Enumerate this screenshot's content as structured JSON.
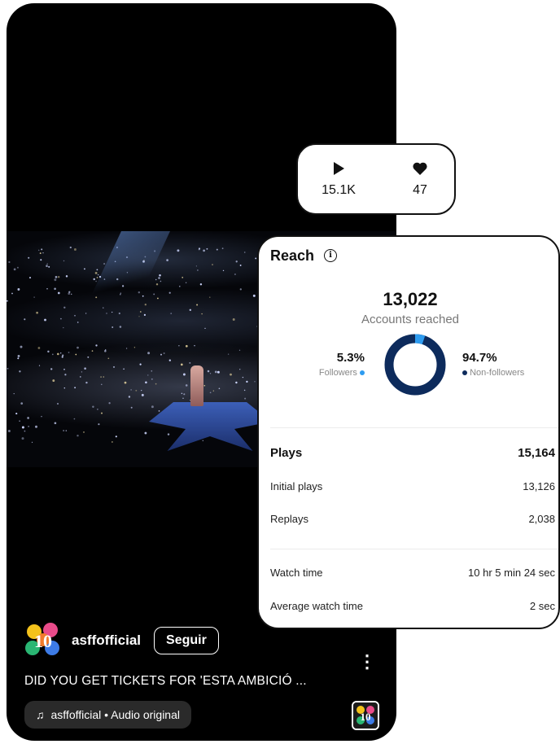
{
  "reel": {
    "account": "asffofficial",
    "follow_label": "Seguir",
    "caption": "DID YOU GET TICKETS FOR 'ESTA AMBICIÓ ...",
    "audio": "asffofficial • Audio original",
    "logo_text": "ASFF 10"
  },
  "stats": {
    "plays": "15.1K",
    "likes": "47"
  },
  "reach": {
    "title": "Reach",
    "accounts_reached": "13,022",
    "accounts_label": "Accounts reached",
    "followers_pct": "5.3%",
    "followers_label": "Followers",
    "nonfollowers_pct": "94.7%",
    "nonfollowers_label": "Non-followers",
    "followers_share": 0.053,
    "colors": {
      "followers": "#2e9cf0",
      "nonfollowers": "#0d2b5c"
    }
  },
  "plays_breakdown": {
    "plays_label": "Plays",
    "plays_value": "15,164",
    "initial_label": "Initial plays",
    "initial_value": "13,126",
    "replays_label": "Replays",
    "replays_value": "2,038",
    "watch_label": "Watch time",
    "watch_value": "10 hr 5 min 24 sec",
    "avg_label": "Average watch time",
    "avg_value": "2 sec"
  }
}
